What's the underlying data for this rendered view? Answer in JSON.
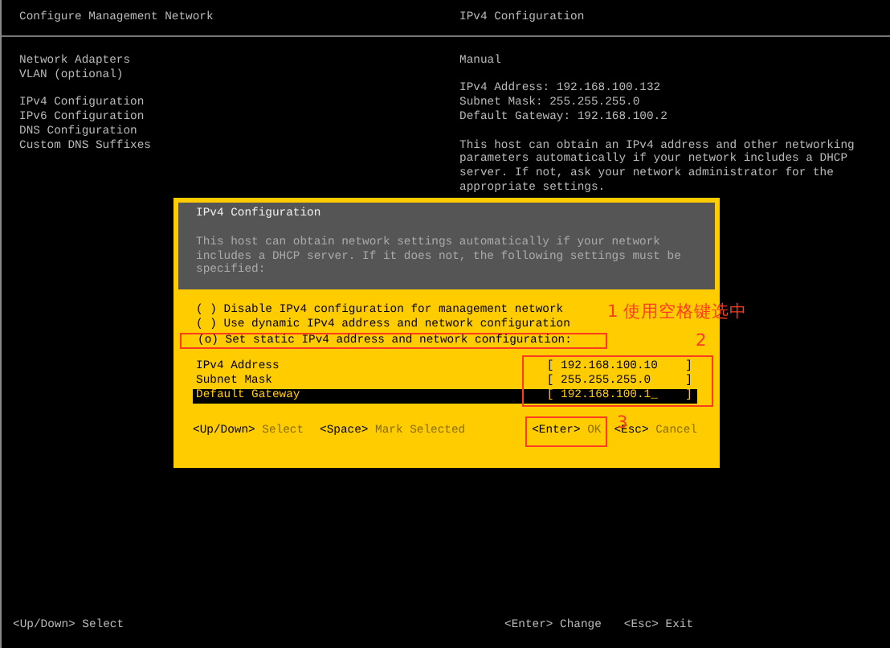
{
  "left_pane": {
    "title": "Configure Management Network",
    "groups": [
      [
        "Network Adapters",
        "VLAN (optional)"
      ],
      [
        "IPv4 Configuration",
        "IPv6 Configuration",
        "DNS Configuration",
        "Custom DNS Suffixes"
      ]
    ]
  },
  "right_pane": {
    "title": "IPv4 Configuration",
    "mode": "Manual",
    "details": [
      "IPv4 Address: 192.168.100.132",
      "Subnet Mask: 255.255.255.0",
      "Default Gateway: 192.168.100.2"
    ],
    "description": "This host can obtain an IPv4 address and other networking parameters automatically if your network includes a DHCP server. If not, ask your network administrator for the appropriate settings."
  },
  "dialog": {
    "title": "IPv4 Configuration",
    "description": "This host can obtain network settings automatically if your network includes a DHCP server. If it does not, the following settings must be specified:",
    "options": [
      {
        "text": "( ) Disable IPv4 configuration for management network"
      },
      {
        "text": "( ) Use dynamic IPv4 address and network configuration"
      },
      {
        "text": "(o) Set static IPv4 address and network configuration:"
      }
    ],
    "fields": [
      {
        "label": "IPv4 Address",
        "value": "[ 192.168.100.10    ]",
        "selected": false
      },
      {
        "label": "Subnet Mask",
        "value": "[ 255.255.255.0     ]",
        "selected": false
      },
      {
        "label": "Default Gateway",
        "value": "[ 192.168.100.1_    ]",
        "selected": true
      }
    ],
    "hints": [
      {
        "key": "<Up/Down>",
        "action": "Select"
      },
      {
        "key": "<Space>",
        "action": "Mark Selected"
      }
    ],
    "buttons": [
      {
        "key": "<Enter>",
        "action": "OK"
      },
      {
        "key": "<Esc>",
        "action": "Cancel"
      }
    ]
  },
  "status_bar": {
    "left": [
      {
        "key": "<Up/Down>",
        "action": "Select"
      }
    ],
    "right": [
      {
        "key": "<Enter>",
        "action": "Change"
      },
      {
        "key": "<Esc>",
        "action": "Exit"
      }
    ]
  },
  "annotations": [
    "1 使用空格键选中",
    "2",
    "3"
  ]
}
